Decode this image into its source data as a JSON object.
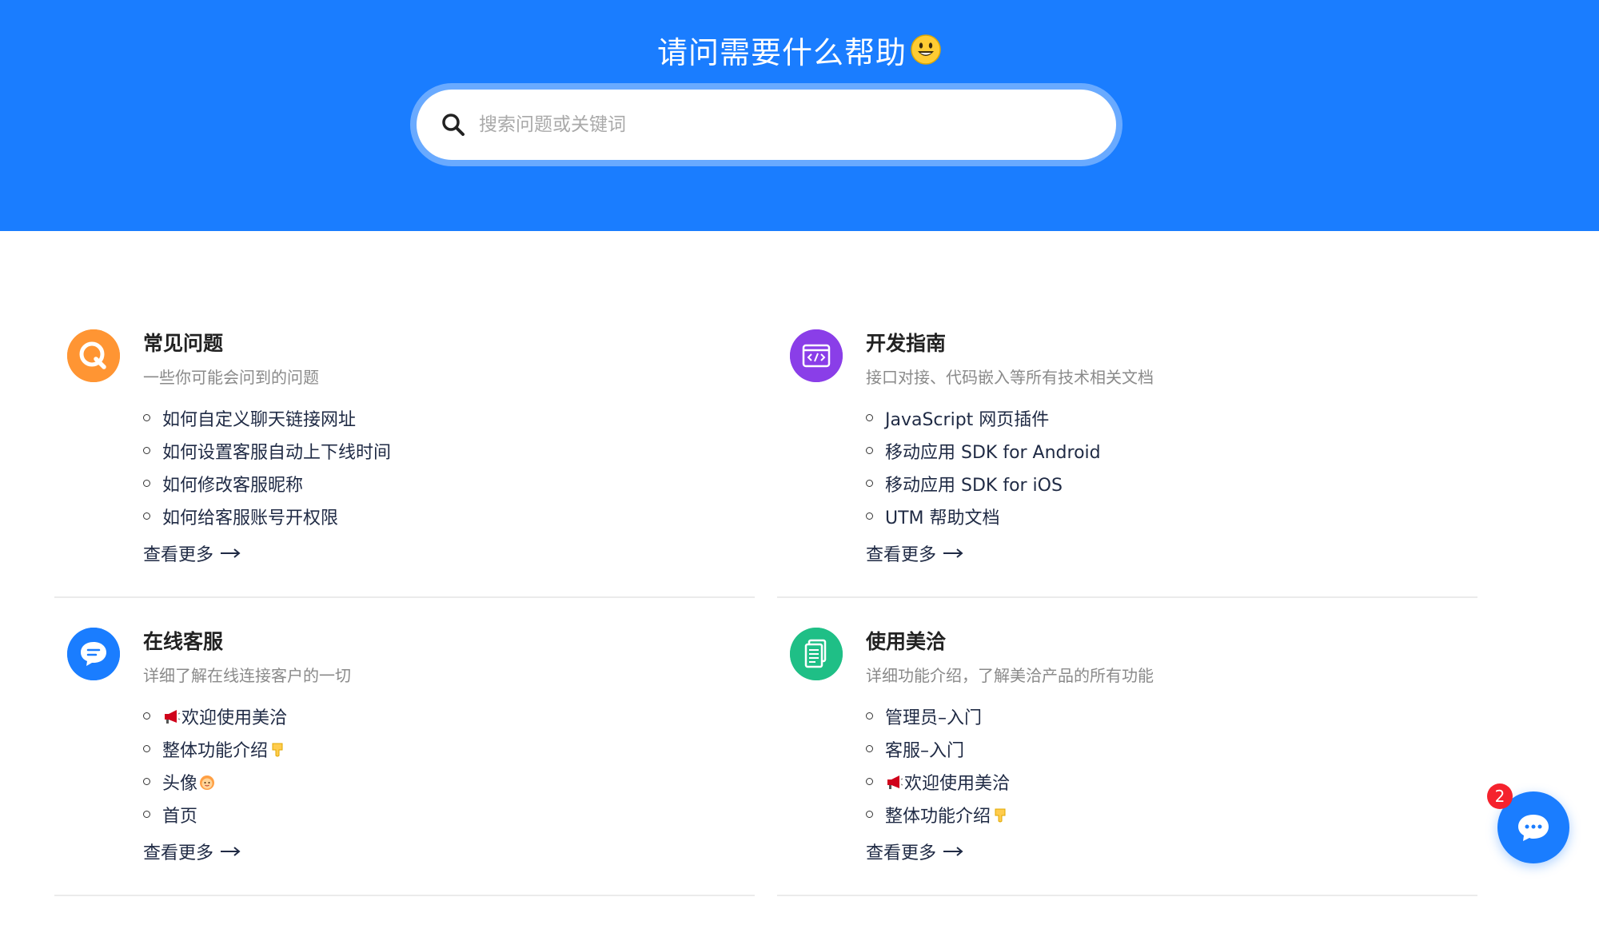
{
  "hero": {
    "title": "请问需要什么帮助",
    "title_emoji": "smiley-face",
    "background_color": "#1a7dff"
  },
  "search": {
    "placeholder": "搜索问题或关键词",
    "value": "",
    "icon": "search-icon"
  },
  "sections": [
    {
      "icon": "q-bubble-icon",
      "icon_color": "#ff9533",
      "title": "常见问题",
      "subtitle": "一些你可能会问到的问题",
      "items": [
        {
          "label": "如何自定义聊天链接网址"
        },
        {
          "label": "如何设置客服自动上下线时间"
        },
        {
          "label": "如何修改客服昵称"
        },
        {
          "label": "如何给客服账号开权限"
        }
      ],
      "more_label": "查看更多"
    },
    {
      "icon": "code-window-icon",
      "icon_color": "#8a3ee8",
      "title": "开发指南",
      "subtitle": "接口对接、代码嵌入等所有技术相关文档",
      "items": [
        {
          "label": "JavaScript 网页插件"
        },
        {
          "label": "移动应用 SDK for Android"
        },
        {
          "label": "移动应用 SDK for iOS"
        },
        {
          "label": "UTM 帮助文档"
        }
      ],
      "more_label": "查看更多"
    },
    {
      "icon": "chat-bubble-icon",
      "icon_color": "#1a7dff",
      "title": "在线客服",
      "subtitle": "详细了解在线连接客户的一切",
      "items": [
        {
          "prefix_icon": "megaphone-icon",
          "label": "欢迎使用美洽"
        },
        {
          "label": "整体功能介绍",
          "suffix_icon": "pointing-down-icon"
        },
        {
          "label": "头像",
          "suffix_icon": "person-emoji-icon"
        },
        {
          "label": "首页"
        }
      ],
      "more_label": "查看更多"
    },
    {
      "icon": "document-icon",
      "icon_color": "#1fbf86",
      "title": "使用美洽",
      "subtitle": "详细功能介绍，了解美洽产品的所有功能",
      "items": [
        {
          "label": "管理员–入门"
        },
        {
          "label": "客服–入门"
        },
        {
          "prefix_icon": "megaphone-icon",
          "label": "欢迎使用美洽"
        },
        {
          "label": "整体功能介绍",
          "suffix_icon": "pointing-down-icon"
        }
      ],
      "more_label": "查看更多"
    }
  ],
  "chat_widget": {
    "icon": "chat-dots-icon",
    "badge_count": "2",
    "color": "#1a7dff",
    "badge_color": "#f5222d"
  }
}
